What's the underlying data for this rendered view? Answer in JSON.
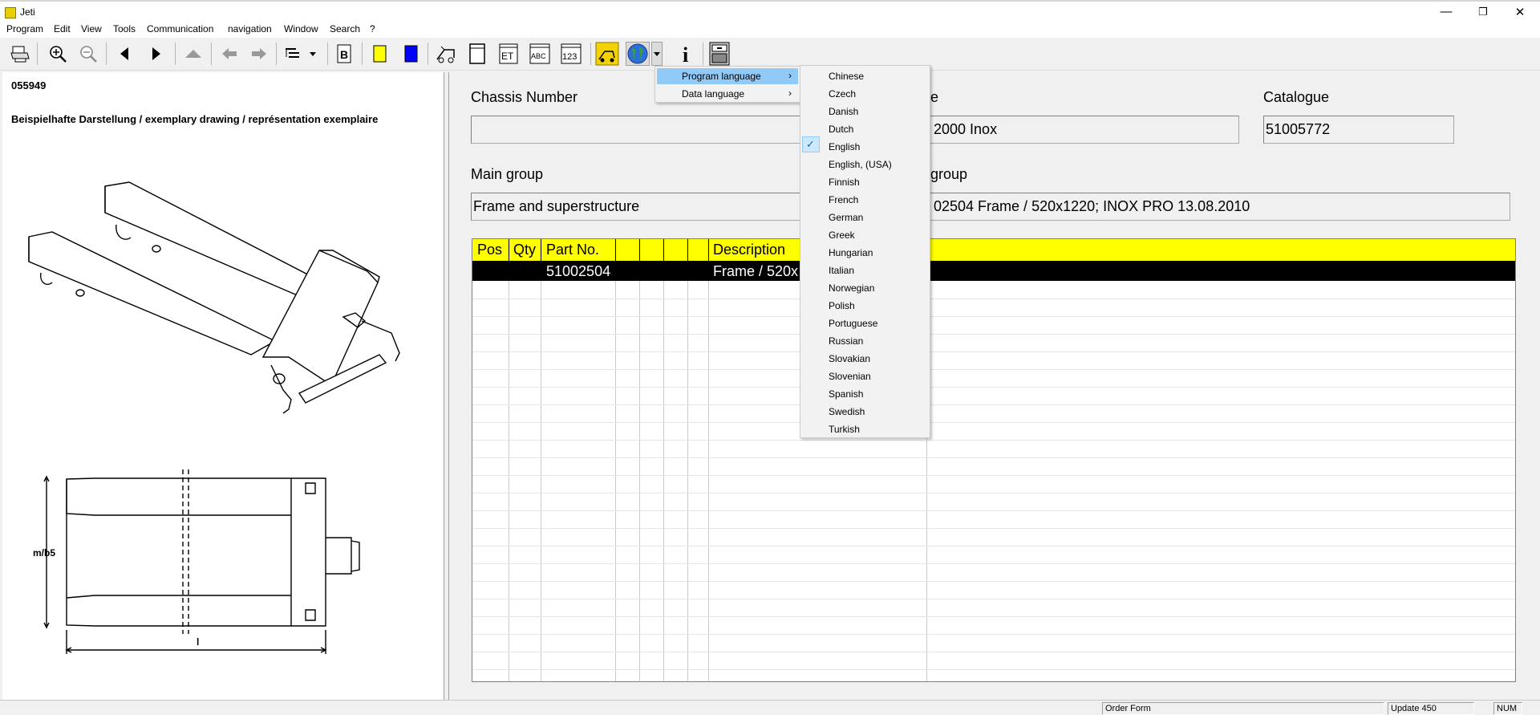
{
  "window": {
    "title": "Jeti",
    "minimize": "—",
    "restore": "❐",
    "close": "✕"
  },
  "menubar": [
    "Program",
    "Edit",
    "View",
    "Tools",
    "Communication",
    "navigation",
    "Window",
    "Search",
    "?"
  ],
  "toolbar": {
    "icons": [
      "printer-icon",
      "zoom-in-icon",
      "zoom-out-icon",
      "arrow-left-icon",
      "arrow-right-icon",
      "arrow-up-icon",
      "back-icon",
      "forward-icon",
      "tree-view-icon",
      "bookmark-icon",
      "yellow-color-icon",
      "blue-color-icon",
      "forklift-icon",
      "document-icon",
      "et-icon",
      "abc-icon",
      "123-icon",
      "machine-icon",
      "globe-icon",
      "info-icon",
      "cabinet-icon"
    ],
    "et_label": "ET",
    "abc_label": "ABC",
    "num_label": "123",
    "info_label": "i"
  },
  "left": {
    "part_id": "055949",
    "caption": "Beispielhafte Darstellung / exemplary drawing / représentation exemplaire",
    "dim_label": "m/b5",
    "length_label": "l"
  },
  "fields": {
    "chassis_label": "Chassis Number",
    "chassis_value": "",
    "type_label": "e",
    "type_value": "2000 Inox",
    "catalogue_label": "Catalogue",
    "catalogue_value": "51005772",
    "main_group_label": "Main group",
    "main_group_value": "Frame and superstructure",
    "group_label": "group",
    "group_value": "02504  Frame / 520x1220; INOX PRO 13.08.2010"
  },
  "table": {
    "columns": [
      "Pos",
      "Qty",
      "Part No.",
      "",
      "",
      "",
      "",
      "Description"
    ],
    "rows": [
      {
        "pos": "",
        "qty": "",
        "part_no": "51002504",
        "description": "Frame / 520x"
      }
    ]
  },
  "menu": {
    "items": [
      {
        "label": "Program language",
        "highlighted": true
      },
      {
        "label": "Data language",
        "highlighted": false
      }
    ],
    "submenu_arrow": "›",
    "languages": [
      "Chinese",
      "Czech",
      "Danish",
      "Dutch",
      "English",
      "English, (USA)",
      "Finnish",
      "French",
      "German",
      "Greek",
      "Hungarian",
      "Italian",
      "Norwegian",
      "Polish",
      "Portuguese",
      "Russian",
      "Slovakian",
      "Slovenian",
      "Spanish",
      "Swedish",
      "Turkish"
    ],
    "selected_language": "English",
    "check_mark": "✓"
  },
  "statusbar": {
    "order_form": "Order Form",
    "update": "Update 450",
    "num": "NUM"
  },
  "colors": {
    "grid_header": "#ffff00",
    "selected_row": "#000000",
    "menu_highlight": "#91c9f7"
  }
}
